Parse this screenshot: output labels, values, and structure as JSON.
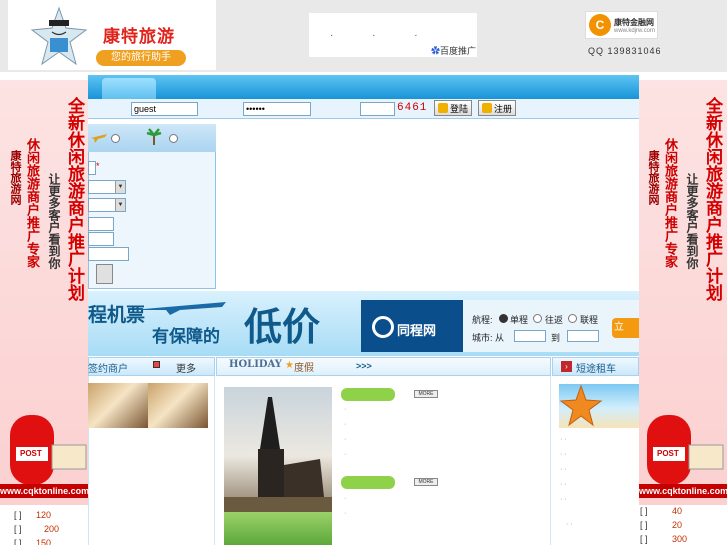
{
  "header": {
    "site_name": "康特旅游",
    "slogan": "您的旅行助手",
    "ad_dots": "· · ·",
    "baidu_label": "百度推广",
    "partner_logo_text": "康特金融网",
    "partner_url": "www.kdjrw.com",
    "qq": "QQ 139831046"
  },
  "login": {
    "username_value": "guest",
    "password_value": "••••••",
    "captcha": "6461",
    "login_button": "登陆",
    "register_button": "注册"
  },
  "booking": {
    "mark": "*"
  },
  "banner": {
    "text1": "程机票",
    "text2": "有保障的",
    "big_text": "低价",
    "brand": "同程网",
    "trip_label": "航程:",
    "option_oneway": "单程",
    "option_round": "往返",
    "option_multi": "联程",
    "city_label": "城市: 从",
    "to_label": "到",
    "search_button": "立"
  },
  "sections": {
    "merchants_title": "签约商户",
    "more_label": "更多",
    "holiday_en": "HOLIDAY",
    "holiday_cn": "度假",
    "holiday_arrows": ">>>",
    "rental_title": "短途租车",
    "more_badge": "MORE"
  },
  "left_list": [
    {
      "bracket": "[ ]",
      "num": "120"
    },
    {
      "bracket": "[ ]",
      "num": "200"
    },
    {
      "bracket": "[ ]",
      "num": "150"
    }
  ],
  "right_list": [
    {
      "bracket": "[ ]",
      "num": "40"
    },
    {
      "bracket": "[ ]",
      "num": "20"
    },
    {
      "bracket": "[ ]",
      "num": "300"
    }
  ],
  "side_ad": {
    "big_text": "全新休闲旅游商户推广计划",
    "mid_text": "休闲旅游商户推广专家",
    "small_text": "康特旅游网",
    "sub_text": "让更多客户看到你",
    "post_label": "POST",
    "url": "www.cqktonline.com"
  },
  "colors": {
    "nav_blue": "#1994d8",
    "accent_red": "#d40000",
    "brand_orange": "#f39a10"
  }
}
